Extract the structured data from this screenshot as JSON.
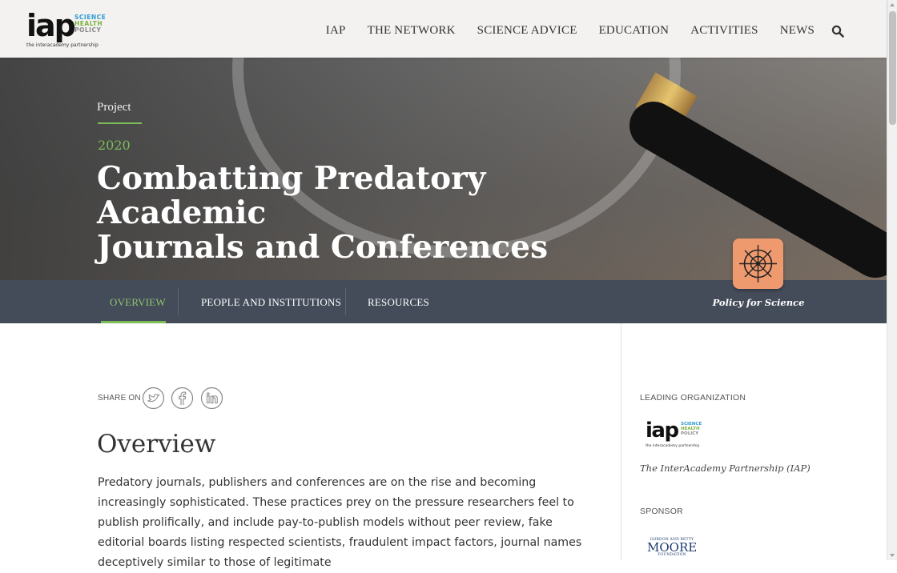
{
  "header": {
    "logo": {
      "main": "iap",
      "line1": "SCIENCE",
      "line2": "HEALTH",
      "line3": "POLICY",
      "tagline": "the interacademy partnership"
    },
    "nav": [
      "IAP",
      "THE NETWORK",
      "SCIENCE ADVICE",
      "EDUCATION",
      "ACTIVITIES",
      "NEWS"
    ]
  },
  "hero": {
    "kicker": "Project",
    "year": "2020",
    "title_line1": "Combatting Predatory Academic",
    "title_line2": "Journals and Conferences"
  },
  "tabs": [
    {
      "label": "OVERVIEW",
      "active": true
    },
    {
      "label": "PEOPLE AND INSTITUTIONS",
      "active": false
    },
    {
      "label": "RESOURCES",
      "active": false
    }
  ],
  "badge": {
    "label": "Policy for Science",
    "icon": "compass-icon",
    "color": "#ef9a6e"
  },
  "share": {
    "label": "SHARE ON",
    "icons": [
      "twitter-icon",
      "facebook-icon",
      "linkedin-icon"
    ]
  },
  "overview": {
    "heading": "Overview",
    "paragraph": "Predatory journals, publishers and conferences are on the rise and becoming increasingly sophisticated. These practices prey on the pressure researchers feel to publish prolifically, and include pay-to-publish models without peer review, fake editorial boards listing respected scientists, fraudulent impact factors, journal names deceptively similar to those of legitimate"
  },
  "sidebar": {
    "leading_label": "LEADING ORGANIZATION",
    "leading_org": "The InterAcademy Partnership (IAP)",
    "sponsor_label": "SPONSOR",
    "sponsor_small": "GORDON AND BETTY",
    "sponsor_big": "MOORE",
    "sponsor_foot": "FOUNDATION"
  },
  "colors": {
    "accent": "#7dbd58",
    "tabbar": "#444c5a",
    "header": "#f3f2f0"
  }
}
